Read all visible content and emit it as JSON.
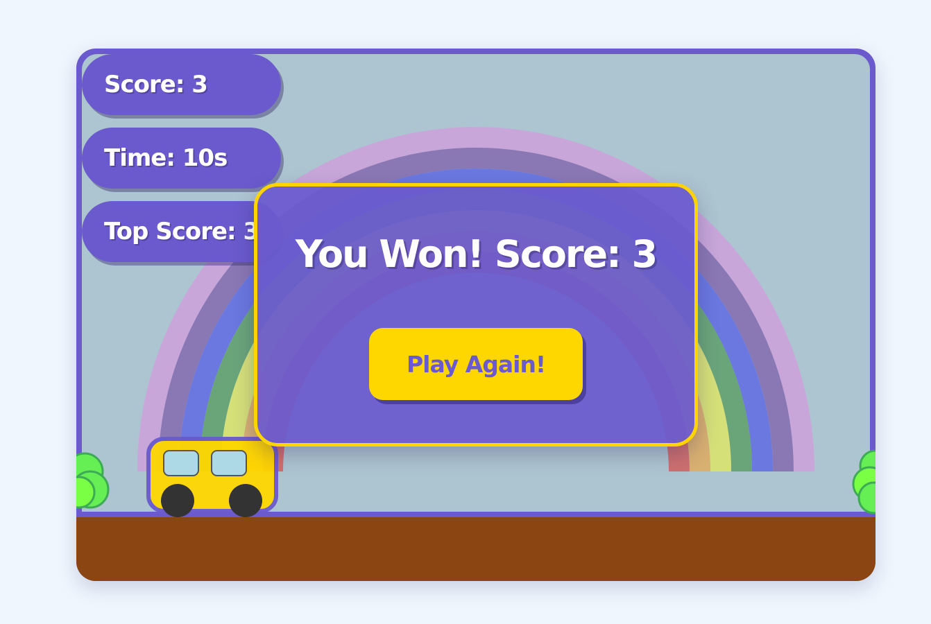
{
  "hud": {
    "score_label": "Score: 3",
    "time_label": "Time: 10s",
    "top_score_label": "Top Score: 3"
  },
  "dialog": {
    "title": "You Won! Score: 3",
    "play_again_label": "Play Again!"
  },
  "colors": {
    "frame": "#6a5acd",
    "sky": "#adc5d0",
    "ground": "#8b4513",
    "accent": "#ffd700",
    "page_background": "#eff6fe"
  },
  "scene": {
    "icons": [
      "rainbow",
      "bus",
      "bush",
      "bush"
    ]
  }
}
